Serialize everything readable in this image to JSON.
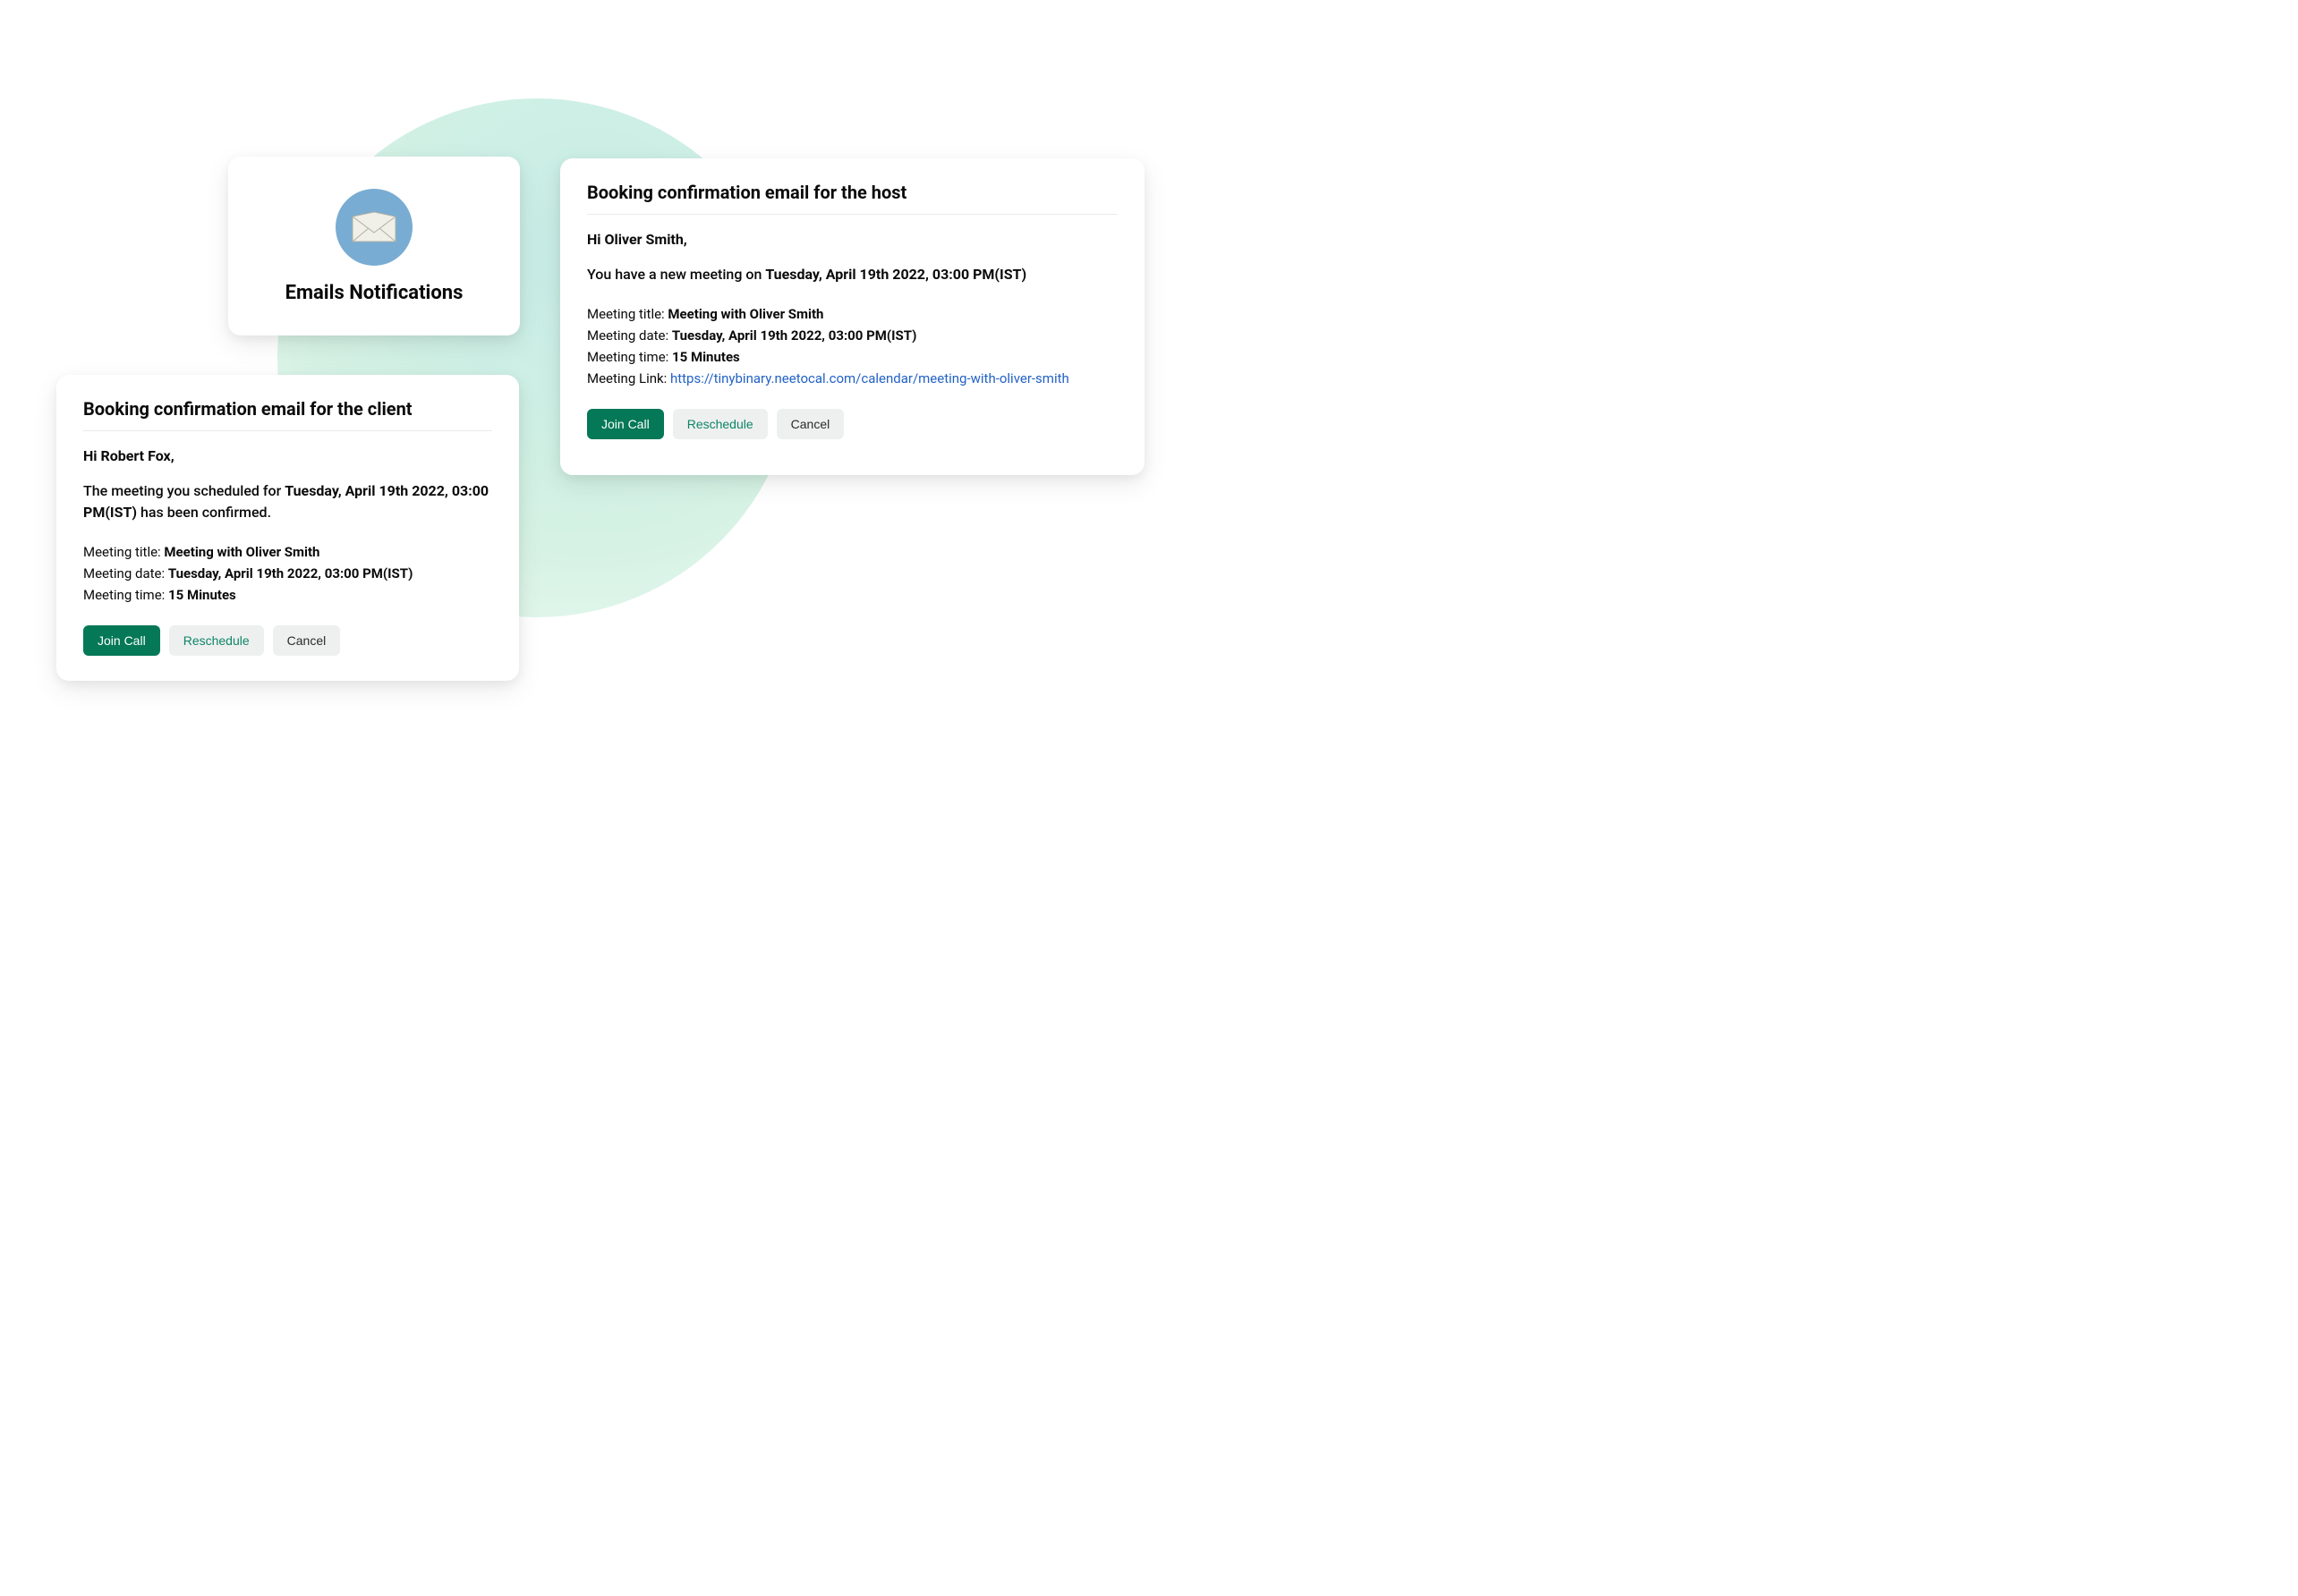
{
  "header": {
    "title": "Emails Notifications"
  },
  "client_card": {
    "title": "Booking confirmation email for the client",
    "greeting": "Hi Robert Fox,",
    "intro_pre": "The meeting you scheduled for ",
    "intro_bold": "Tuesday, April 19th 2022, 03:00 PM(IST)",
    "intro_post": "  has been confirmed.",
    "meta": {
      "title_label": "Meeting title: ",
      "title_value": "Meeting with Oliver Smith",
      "date_label": "Meeting date: ",
      "date_value": "Tuesday, April 19th 2022, 03:00 PM(IST)",
      "time_label": "Meeting time: ",
      "time_value": "15 Minutes"
    },
    "buttons": {
      "join": "Join Call",
      "reschedule": "Reschedule",
      "cancel": "Cancel"
    }
  },
  "host_card": {
    "title": "Booking confirmation email for the host",
    "greeting": "Hi Oliver Smith,",
    "intro_pre": "You have a new meeting on ",
    "intro_bold": "Tuesday, April 19th 2022, 03:00 PM(IST)",
    "meta": {
      "title_label": "Meeting title: ",
      "title_value": "Meeting with Oliver Smith",
      "date_label": "Meeting date: ",
      "date_value": "Tuesday, April 19th 2022, 03:00 PM(IST)",
      "time_label": "Meeting time: ",
      "time_value": "15 Minutes",
      "link_label": "Meeting Link: ",
      "link_value": "https://tinybinary.neetocal.com/calendar/meeting-with-oliver-smith"
    },
    "buttons": {
      "join": "Join Call",
      "reschedule": "Reschedule",
      "cancel": "Cancel"
    }
  }
}
